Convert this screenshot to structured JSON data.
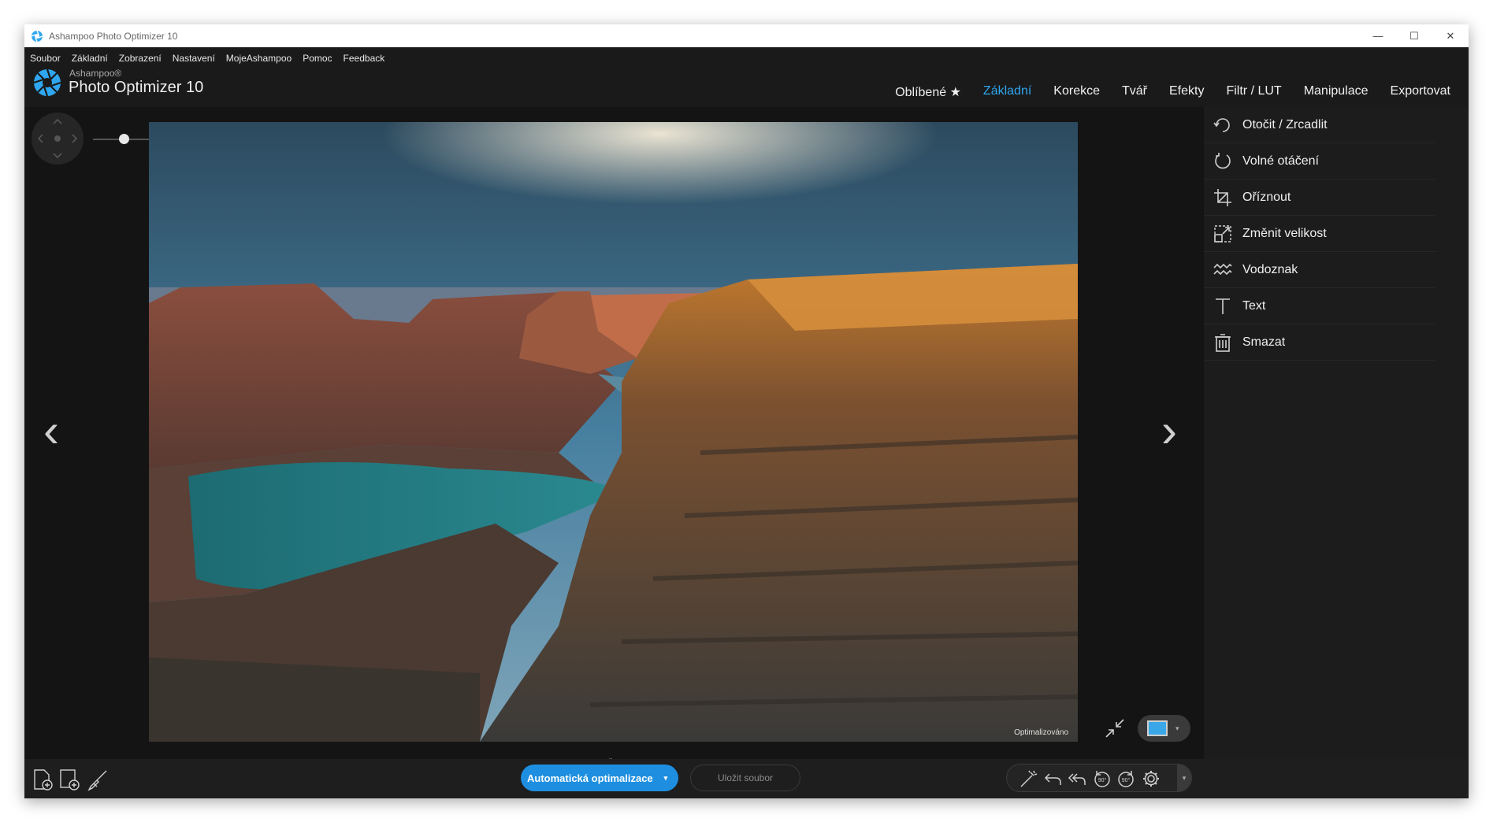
{
  "window": {
    "title": "Ashampoo Photo Optimizer 10"
  },
  "menu": [
    "Soubor",
    "Základní",
    "Zobrazení",
    "Nastavení",
    "MojeAshampoo",
    "Pomoc",
    "Feedback"
  ],
  "brand": {
    "small": "Ashampoo®",
    "big": "Photo Optimizer 10"
  },
  "tabs": [
    {
      "label": "Oblíbené ★"
    },
    {
      "label": "Základní"
    },
    {
      "label": "Korekce"
    },
    {
      "label": "Tvář"
    },
    {
      "label": "Efekty"
    },
    {
      "label": "Filtr / LUT"
    },
    {
      "label": "Manipulace"
    },
    {
      "label": "Exportovat"
    }
  ],
  "active_tab": "Základní",
  "tools": [
    {
      "label": "Otočit / Zrcadlit",
      "icon": "rotate-mirror-icon"
    },
    {
      "label": "Volné otáčení",
      "icon": "free-rotate-icon"
    },
    {
      "label": "Oříznout",
      "icon": "crop-icon"
    },
    {
      "label": "Změnit velikost",
      "icon": "resize-icon"
    },
    {
      "label": "Vodoznak",
      "icon": "watermark-icon"
    },
    {
      "label": "Text",
      "icon": "text-icon"
    },
    {
      "label": "Smazat",
      "icon": "delete-icon"
    }
  ],
  "photo": {
    "status": "Optimalizováno"
  },
  "zoom": {
    "level": 0.3
  },
  "bottom": {
    "auto_label": "Automatická optimalizace",
    "save_label": "Uložit soubor"
  },
  "colors": {
    "accent": "#1e8fe0",
    "tab_active": "#2ea7f0",
    "background": "#141414",
    "panel": "#1c1c1c"
  }
}
